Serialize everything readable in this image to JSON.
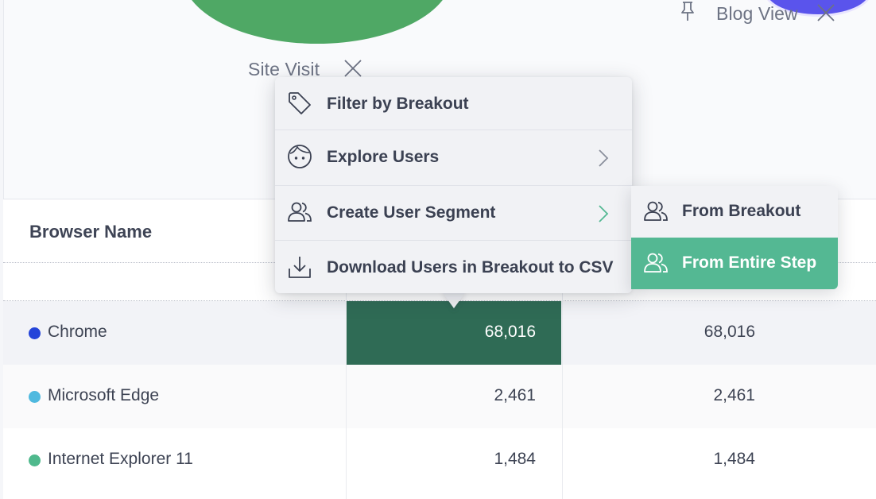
{
  "chart": {
    "steps": [
      {
        "label": "Site Visit"
      },
      {
        "label": "Blog View"
      }
    ],
    "colors": {
      "step1": "#4fa865",
      "step2": "#5a54ec"
    }
  },
  "table": {
    "header": {
      "browser_name": "Browser Name"
    },
    "rows": [
      {
        "name": "Chrome",
        "color": "#2444d9",
        "value1": "68,016",
        "value2": "68,016",
        "selected": true
      },
      {
        "name": "Microsoft Edge",
        "color": "#4fb9df",
        "value1": "2,461",
        "value2": "2,461",
        "selected": false
      },
      {
        "name": "Internet Explorer 11",
        "color": "#4fb98d",
        "value1": "1,484",
        "value2": "1,484",
        "selected": false
      }
    ],
    "colors": {
      "selected_cell": "#2f6b55"
    }
  },
  "menu": {
    "items": [
      {
        "label": "Filter by Breakout",
        "icon": "tag-icon",
        "has_submenu": false
      },
      {
        "label": "Explore Users",
        "icon": "user-face-icon",
        "has_submenu": true
      },
      {
        "label": "Create User Segment",
        "icon": "users-icon",
        "has_submenu": true
      },
      {
        "label": "Download Users in Breakout to CSV",
        "icon": "download-icon",
        "has_submenu": false
      }
    ],
    "submenu": {
      "items": [
        {
          "label": "From Breakout",
          "icon": "users-icon",
          "active": false
        },
        {
          "label": "From Entire Step",
          "icon": "users-icon",
          "active": true
        }
      ],
      "colors": {
        "active": "#54b893"
      }
    }
  }
}
